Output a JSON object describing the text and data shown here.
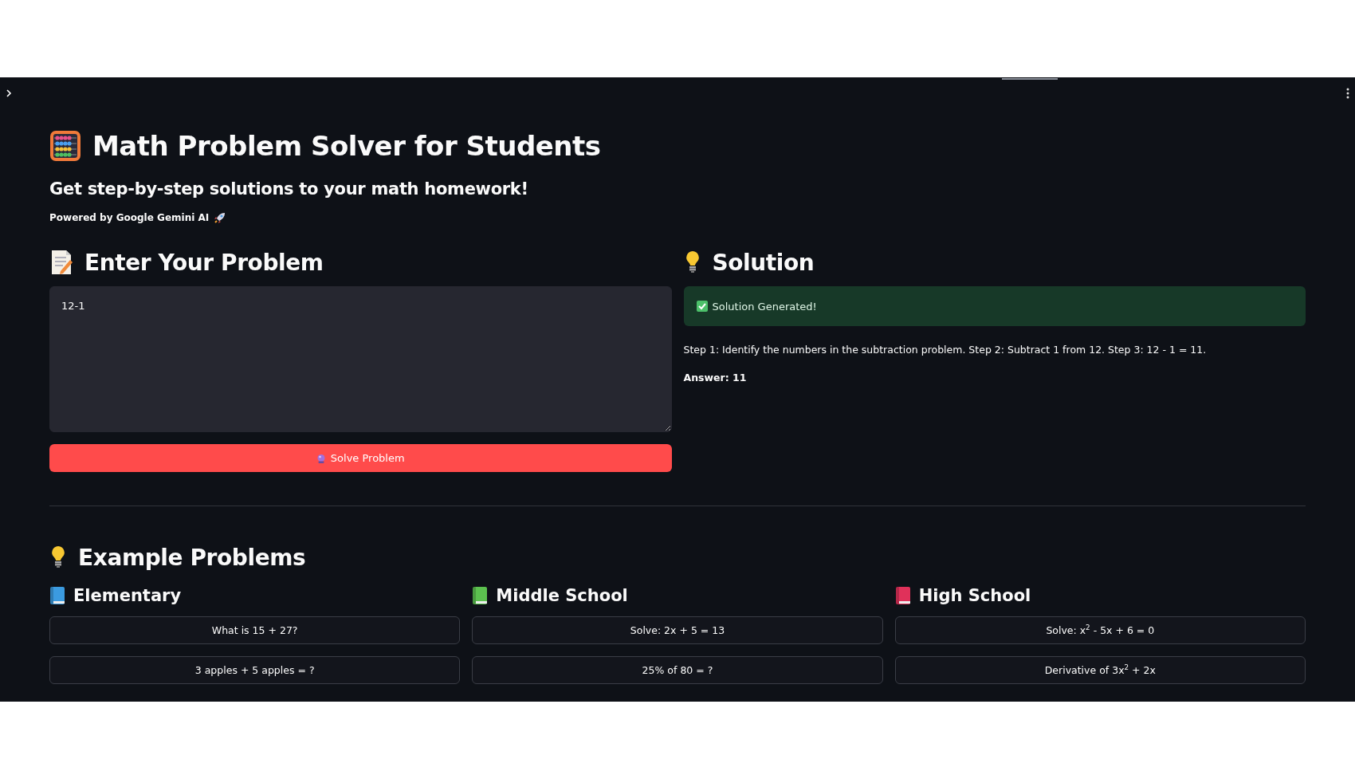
{
  "title": "Math Problem Solver for Students",
  "subtitle": "Get step-by-step solutions to your math homework!",
  "powered_by": "Powered by Google Gemini AI",
  "input_section": {
    "heading": "Enter Your Problem",
    "value": "12-1",
    "button": "Solve Problem"
  },
  "solution_section": {
    "heading": "Solution",
    "status": "Solution Generated!",
    "steps": "Step 1: Identify the numbers in the subtraction problem. Step 2: Subtract 1 from 12. Step 3: 12 - 1 = 11.",
    "answer": "Answer: 11"
  },
  "examples": {
    "heading": "Example Problems",
    "columns": [
      {
        "title": "Elementary",
        "color": "#3b9be0",
        "problems": [
          "What is 15 + 27?",
          "3 apples + 5 apples = ?"
        ]
      },
      {
        "title": "Middle School",
        "color": "#5cc14f",
        "problems": [
          "Solve: 2x + 5 = 13",
          "25% of 80 = ?"
        ]
      },
      {
        "title": "High School",
        "color": "#e0315a",
        "problems": [
          "Solve: x$^{2}$ - 5x + 6 = 0",
          "Derivative of 3x$^{2}$ + 2x"
        ]
      }
    ]
  }
}
